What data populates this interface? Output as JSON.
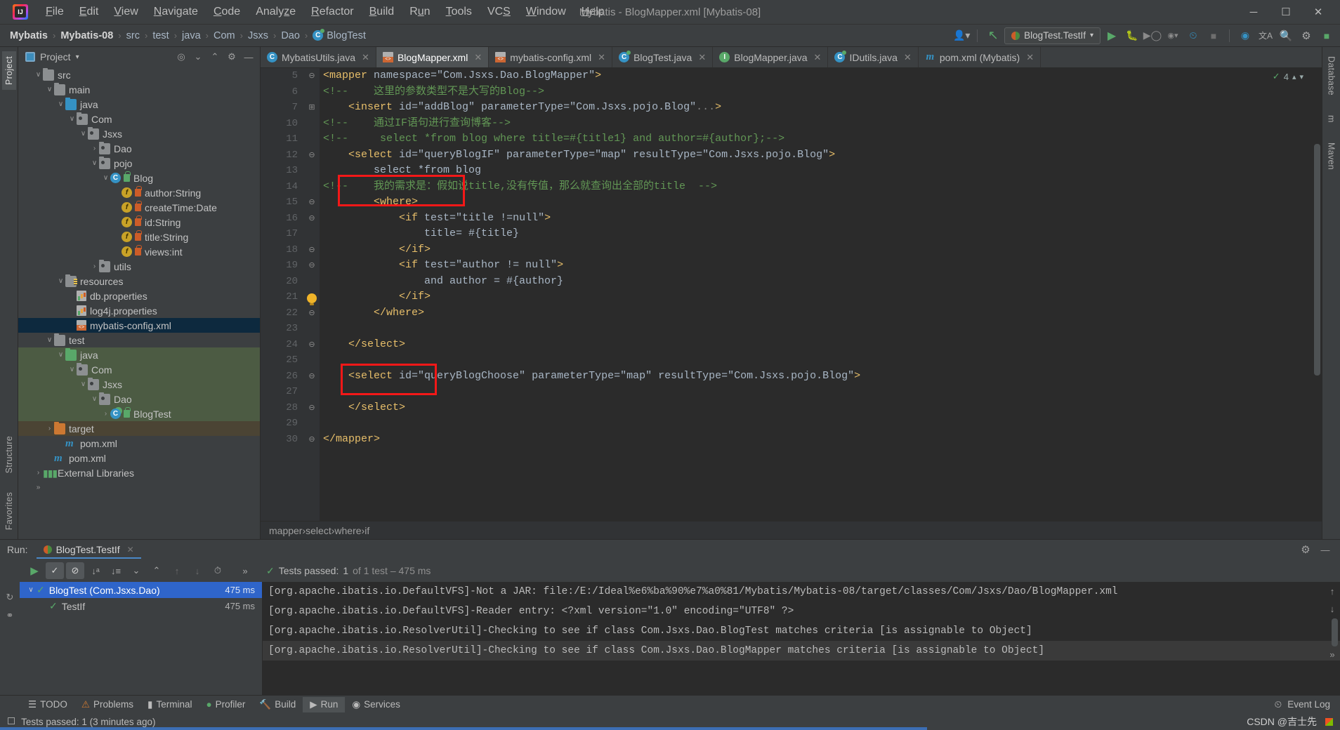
{
  "window": {
    "title": "Mybatis - BlogMapper.xml [Mybatis-08]",
    "minimize": "─",
    "maximize": "☐",
    "close": "✕"
  },
  "menubar": {
    "items": [
      "File",
      "Edit",
      "View",
      "Navigate",
      "Code",
      "Analyze",
      "Refactor",
      "Build",
      "Run",
      "Tools",
      "VCS",
      "Window",
      "Help"
    ]
  },
  "navbar": {
    "breadcrumbs": [
      "Mybatis",
      "Mybatis-08",
      "src",
      "test",
      "java",
      "Com",
      "Jsxs",
      "Dao",
      "BlogTest"
    ],
    "separator": "›",
    "run_config": "BlogTest.TestIf",
    "icons": {
      "profile": "profile-icon",
      "updown": "update-project-icon",
      "run": "▶",
      "debug": "debug-icon",
      "coverage": "coverage-icon",
      "profiler": "profiler-icon",
      "stop": "■",
      "search_everywhere": "⌕",
      "settings": "⚙",
      "translate": "translate-icon"
    }
  },
  "left_strip": {
    "top": "Project",
    "bottom": [
      "Structure",
      "Favorites"
    ]
  },
  "right_strip": {
    "items": [
      "Database",
      "m",
      "Maven"
    ]
  },
  "project_panel": {
    "title": "Project",
    "chevron": "▾",
    "actions": [
      "locate-icon",
      "expand-all-icon",
      "collapse-all-icon",
      "gear-icon",
      "hide-icon"
    ],
    "tree": [
      {
        "label": "src",
        "indent": 1,
        "arrow": "∨",
        "icon": "folder-gray",
        "row": ""
      },
      {
        "label": "main",
        "indent": 2,
        "arrow": "∨",
        "icon": "folder-gray",
        "row": ""
      },
      {
        "label": "java",
        "indent": 3,
        "arrow": "∨",
        "icon": "folder-blue",
        "row": ""
      },
      {
        "label": "Com",
        "indent": 4,
        "arrow": "∨",
        "icon": "package",
        "row": ""
      },
      {
        "label": "Jsxs",
        "indent": 5,
        "arrow": "∨",
        "icon": "package",
        "row": ""
      },
      {
        "label": "Dao",
        "indent": 6,
        "arrow": "›",
        "icon": "package",
        "row": ""
      },
      {
        "label": "pojo",
        "indent": 6,
        "arrow": "∨",
        "icon": "package",
        "row": ""
      },
      {
        "label": "Blog",
        "indent": 7,
        "arrow": "∨",
        "icon": "class-lock-green",
        "row": ""
      },
      {
        "label": "author:String",
        "indent": 8,
        "arrow": "",
        "icon": "field-lock",
        "row": ""
      },
      {
        "label": "createTime:Date",
        "indent": 8,
        "arrow": "",
        "icon": "field-lock",
        "row": ""
      },
      {
        "label": "id:String",
        "indent": 8,
        "arrow": "",
        "icon": "field-lock",
        "row": ""
      },
      {
        "label": "title:String",
        "indent": 8,
        "arrow": "",
        "icon": "field-lock",
        "row": ""
      },
      {
        "label": "views:int",
        "indent": 8,
        "arrow": "",
        "icon": "field-lock",
        "row": ""
      },
      {
        "label": "utils",
        "indent": 6,
        "arrow": "›",
        "icon": "package",
        "row": ""
      },
      {
        "label": "resources",
        "indent": 3,
        "arrow": "∨",
        "icon": "folder-resources",
        "row": ""
      },
      {
        "label": "db.properties",
        "indent": 4,
        "arrow": "",
        "icon": "properties",
        "row": ""
      },
      {
        "label": "log4j.properties",
        "indent": 4,
        "arrow": "",
        "icon": "properties",
        "row": ""
      },
      {
        "label": "mybatis-config.xml",
        "indent": 4,
        "arrow": "",
        "icon": "xml",
        "row": "sel"
      },
      {
        "label": "test",
        "indent": 2,
        "arrow": "∨",
        "icon": "folder-gray",
        "row": ""
      },
      {
        "label": "java",
        "indent": 3,
        "arrow": "∨",
        "icon": "folder-green",
        "row": "greenbg"
      },
      {
        "label": "Com",
        "indent": 4,
        "arrow": "∨",
        "icon": "package",
        "row": "greenbg"
      },
      {
        "label": "Jsxs",
        "indent": 5,
        "arrow": "∨",
        "icon": "package",
        "row": "greenbg"
      },
      {
        "label": "Dao",
        "indent": 6,
        "arrow": "∨",
        "icon": "package",
        "row": "greenbg"
      },
      {
        "label": "BlogTest",
        "indent": 7,
        "arrow": "›",
        "icon": "test-lock-green",
        "row": "greenbg"
      },
      {
        "label": "target",
        "indent": 2,
        "arrow": "›",
        "icon": "folder-orange",
        "row": "tanbg"
      },
      {
        "label": "pom.xml",
        "indent": 3,
        "arrow": "",
        "icon": "maven",
        "row": ""
      },
      {
        "label": "pom.xml",
        "indent": 2,
        "arrow": "",
        "icon": "maven",
        "row": ""
      },
      {
        "label": "External Libraries",
        "indent": 1,
        "arrow": "›",
        "icon": "library",
        "row": ""
      },
      {
        "label": "",
        "indent": 1,
        "arrow": "»",
        "icon": "none",
        "row": ""
      }
    ]
  },
  "editor_tabs": [
    {
      "label": "MybatisUtils.java",
      "icon": "java-class",
      "active": false,
      "close": "✕"
    },
    {
      "label": "BlogMapper.xml",
      "icon": "xml",
      "active": true,
      "close": "✕"
    },
    {
      "label": "mybatis-config.xml",
      "icon": "xml",
      "active": false,
      "close": "✕"
    },
    {
      "label": "BlogTest.java",
      "icon": "java-test",
      "active": false,
      "close": "✕"
    },
    {
      "label": "BlogMapper.java",
      "icon": "java-iface",
      "active": false,
      "close": "✕"
    },
    {
      "label": "IDutils.java",
      "icon": "java-test",
      "active": false,
      "close": "✕"
    },
    {
      "label": "pom.xml (Mybatis)",
      "icon": "maven",
      "active": false,
      "close": "✕"
    }
  ],
  "editor": {
    "inspection_count": "4",
    "lines": [
      {
        "num": "5",
        "fold": "⊖",
        "text": "<mapper namespace=\"Com.Jsxs.Dao.BlogMapper\">"
      },
      {
        "num": "6",
        "fold": "",
        "text": "<!--    这里的参数类型不是大写的Blog-->"
      },
      {
        "num": "7",
        "fold": "⊞",
        "text": "    <insert id=\"addBlog\" parameterType=\"Com.Jsxs.pojo.Blog\"...>"
      },
      {
        "num": "10",
        "fold": "",
        "text": "<!--    通过IF语句进行查询博客-->"
      },
      {
        "num": "11",
        "fold": "",
        "text": "<!--     select *from blog where title=#{title1} and author=#{author};-->"
      },
      {
        "num": "12",
        "fold": "⊖",
        "text": "    <select id=\"queryBlogIF\" parameterType=\"map\" resultType=\"Com.Jsxs.pojo.Blog\">"
      },
      {
        "num": "13",
        "fold": "",
        "text": "        select *from blog"
      },
      {
        "num": "14",
        "fold": "",
        "text": "<!--    我的需求是：假如说title,没有传值，那么就查询出全部的title  -->"
      },
      {
        "num": "15",
        "fold": "⊖",
        "text": "        <where>"
      },
      {
        "num": "16",
        "fold": "⊖",
        "text": "            <if test=\"title !=null\">"
      },
      {
        "num": "17",
        "fold": "",
        "text": "                title= #{title}"
      },
      {
        "num": "18",
        "fold": "⊖",
        "text": "            </if>"
      },
      {
        "num": "19",
        "fold": "⊖",
        "text": "            <if test=\"author != null\">"
      },
      {
        "num": "20",
        "fold": "",
        "text": "                and author = #{author}"
      },
      {
        "num": "21",
        "fold": "⊖",
        "text": "            </if>"
      },
      {
        "num": "22",
        "fold": "⊖",
        "text": "        </where>"
      },
      {
        "num": "23",
        "fold": "",
        "text": ""
      },
      {
        "num": "24",
        "fold": "⊖",
        "text": "    </select>"
      },
      {
        "num": "25",
        "fold": "",
        "text": ""
      },
      {
        "num": "26",
        "fold": "⊖",
        "text": "    <select id=\"queryBlogChoose\" parameterType=\"map\" resultType=\"Com.Jsxs.pojo.Blog\">"
      },
      {
        "num": "27",
        "fold": "",
        "text": ""
      },
      {
        "num": "28",
        "fold": "⊖",
        "text": "    </select>"
      },
      {
        "num": "29",
        "fold": "",
        "text": ""
      },
      {
        "num": "30",
        "fold": "⊖",
        "text": "</mapper>"
      }
    ],
    "breadcrumb": [
      "mapper",
      "select",
      "where",
      "if"
    ],
    "breadcrumb_sep": "›"
  },
  "run_panel": {
    "label": "Run:",
    "tab": "BlogTest.TestIf",
    "tab_close": "✕",
    "toolbar_icons": [
      "rerun-icon",
      "show-passed-icon",
      "hide-ignored-icon",
      "sort-alpha-icon",
      "sort-duration-icon",
      "expand-all-icon",
      "collapse-all-icon",
      "prev-test-icon",
      "next-test-icon",
      "history-icon"
    ],
    "more": "»",
    "status_prefix": "Tests passed:",
    "status_count": "1",
    "status_suffix": "of 1 test – 475 ms",
    "tests": [
      {
        "label": "BlogTest (Com.Jsxs.Dao)",
        "time": "475 ms",
        "arrow": "∨",
        "selected": true
      },
      {
        "label": "TestIf",
        "time": "475 ms",
        "arrow": "",
        "selected": false
      }
    ],
    "console": [
      "[org.apache.ibatis.io.DefaultVFS]-Not a JAR: file:/E:/Ideal%e6%ba%90%e7%a0%81/Mybatis/Mybatis-08/target/classes/Com/Jsxs/Dao/BlogMapper.xml",
      "[org.apache.ibatis.io.DefaultVFS]-Reader entry: <?xml version=\"1.0\" encoding=\"UTF8\" ?>",
      "[org.apache.ibatis.io.ResolverUtil]-Checking to see if class Com.Jsxs.Dao.BlogTest matches criteria [is assignable to Object]",
      "[org.apache.ibatis.io.ResolverUtil]-Checking to see if class Com.Jsxs.Dao.BlogMapper matches criteria [is assignable to Object]"
    ]
  },
  "toolwindow_bar": {
    "items": [
      {
        "label": "TODO",
        "icon": "todo-icon",
        "active": false
      },
      {
        "label": "Problems",
        "icon": "problems-icon",
        "active": false
      },
      {
        "label": "Terminal",
        "icon": "terminal-icon",
        "active": false
      },
      {
        "label": "Profiler",
        "icon": "profiler-icon",
        "active": false
      },
      {
        "label": "Build",
        "icon": "build-icon",
        "active": false
      },
      {
        "label": "Run",
        "icon": "run-icon",
        "active": true
      },
      {
        "label": "Services",
        "icon": "services-icon",
        "active": false
      }
    ],
    "event_log": "Event Log"
  },
  "statusbar": {
    "message": "Tests passed: 1 (3 minutes ago)",
    "watermark": "CSDN @吉士先",
    "icon": "layout-icon"
  },
  "colors": {
    "accent_blue": "#3c6eb4",
    "highlight_red": "#f41818",
    "selection_blue": "#2f65ca",
    "tree_selection": "#0d293e",
    "test_green": "#59a869",
    "string_green": "#6a8759",
    "comment_green": "#629755",
    "tag_yellow": "#e8bf6a"
  }
}
